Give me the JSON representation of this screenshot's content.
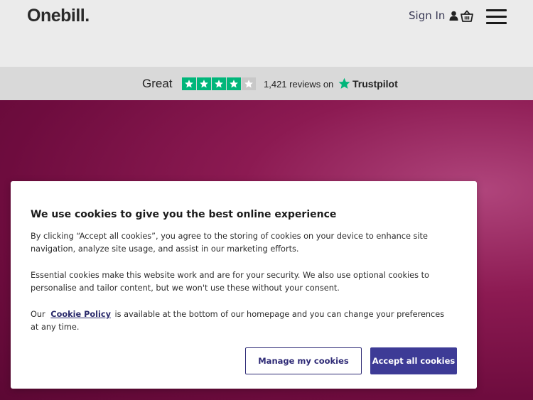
{
  "header": {
    "logo_text": "Onebill.",
    "signin_label": "Sign In",
    "icons": [
      "user-icon",
      "basket-icon",
      "hamburger-menu-icon"
    ]
  },
  "trustpilot": {
    "rating_label": "Great",
    "stars_filled": 4,
    "stars_total": 5,
    "reviews_text": "1,421 reviews on",
    "brand": "Trustpilot",
    "star_color": "#00b67a"
  },
  "cookie_banner": {
    "title": "We use cookies to give you the best online experience",
    "paragraph1": "By clicking “Accept all cookies”, you agree to the storing of cookies on your device to enhance site navigation, analyze site usage, and assist in our marketing efforts.",
    "paragraph2": "Essential cookies make this website work and are for your security. We also use optional cookies to personalise and tailor content, but we won't use these without your consent.",
    "paragraph3_prefix": "Our",
    "paragraph3_link": "Cookie Policy",
    "paragraph3_suffix": "is available at the bottom of our homepage and you can change your preferences at any time.",
    "manage_button": "Manage my cookies",
    "accept_button": "Accept all cookies"
  },
  "colors": {
    "accent": "#3d3b96",
    "hero": "#8c1a52"
  }
}
